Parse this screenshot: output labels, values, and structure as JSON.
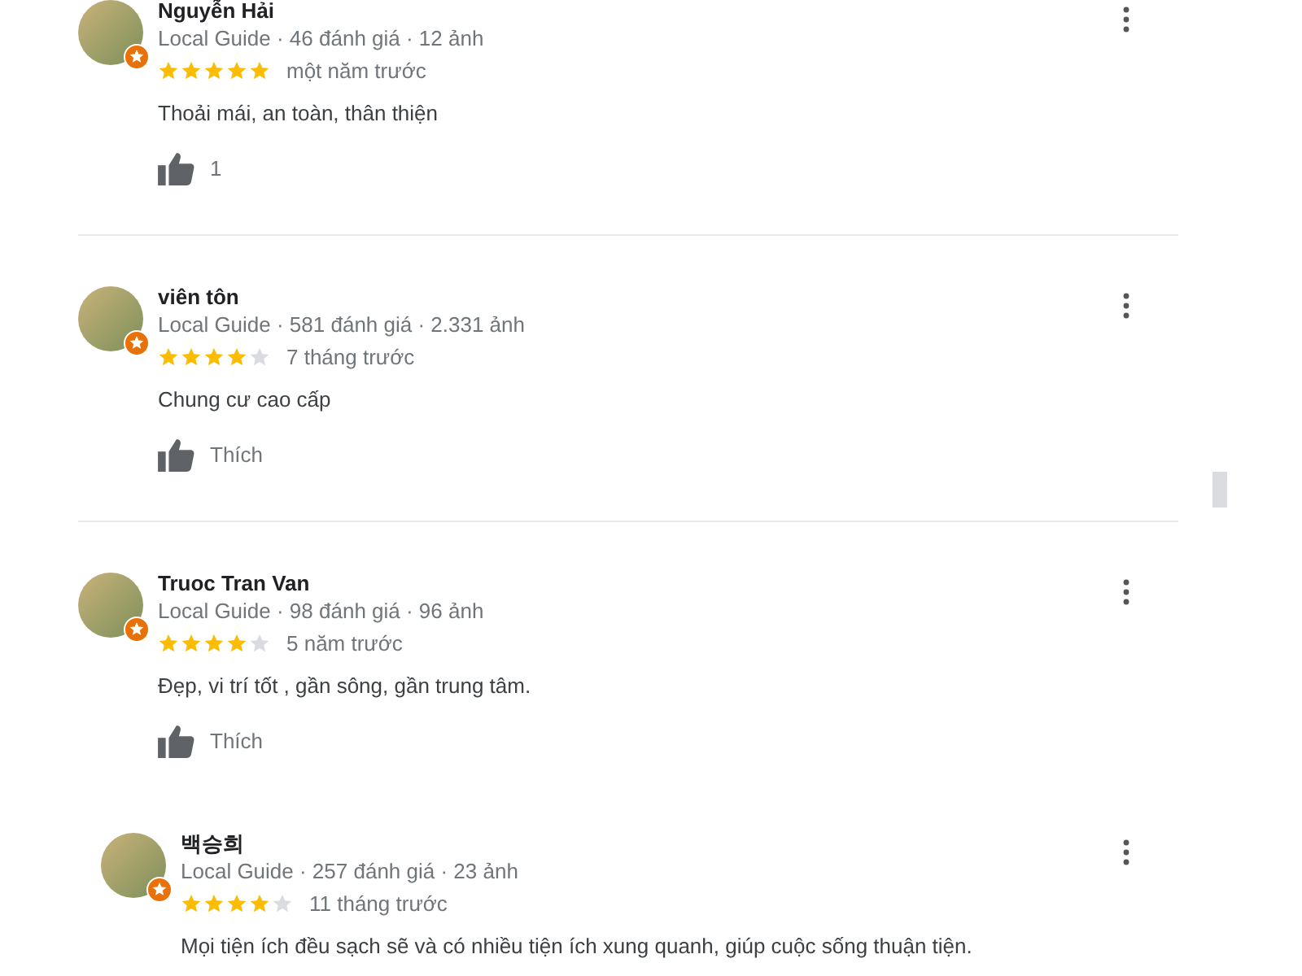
{
  "reviews": [
    {
      "kind": "review",
      "name": "Nguyễn Hải",
      "meta": "Local Guide · 46 đánh giá · 12 ảnh",
      "stars": 5,
      "time": "một năm trước",
      "text": "Thoải mái, an toàn, thân thiện",
      "like_label": "1"
    },
    {
      "kind": "review",
      "name": "viên tôn",
      "meta": "Local Guide · 581 đánh giá · 2.331 ảnh",
      "stars": 4,
      "time": "7 tháng trước",
      "text": "Chung cư cao cấp",
      "like_label": "Thích"
    },
    {
      "kind": "review",
      "name": "Truoc Tran Van",
      "meta": "Local Guide · 98 đánh giá · 96 ảnh",
      "stars": 4,
      "time": "5 năm trước",
      "text": "Đẹp, vi trí tốt , gần sông, gần trung tâm.",
      "like_label": "Thích"
    },
    {
      "kind": "nested",
      "name": "백승희",
      "meta": "Local Guide · 257 đánh giá · 23 ảnh",
      "stars": 4,
      "time": "11 tháng trước",
      "text": "Mọi tiện ích đều sạch sẽ và có nhiều tiện ích xung quanh, giúp cuộc sống thuận tiện."
    }
  ]
}
